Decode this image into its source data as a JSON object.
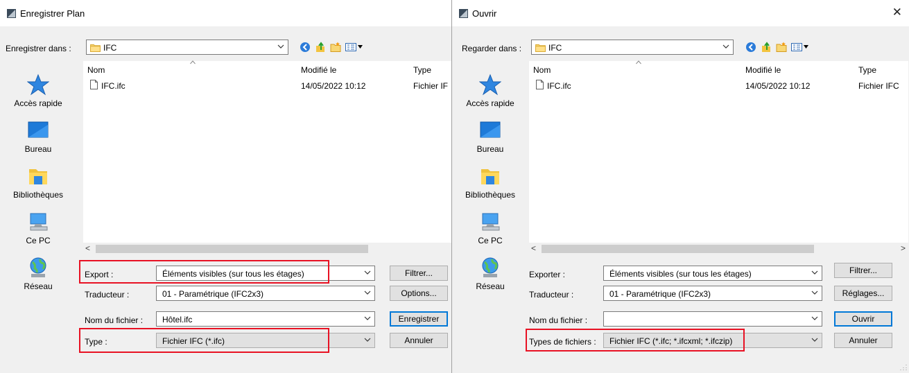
{
  "save_dialog": {
    "title": "Enregistrer Plan",
    "look_in_label": "Enregistrer dans :",
    "folder": "IFC",
    "places": [
      "Accès rapide",
      "Bureau",
      "Bibliothèques",
      "Ce PC",
      "Réseau"
    ],
    "columns": {
      "name": "Nom",
      "modified": "Modifié le",
      "type": "Type"
    },
    "files": [
      {
        "name": "IFC.ifc",
        "modified": "14/05/2022 10:12",
        "type": "Fichier IF"
      }
    ],
    "scroll_left": "<",
    "export_label": "Export :",
    "export_value": "Éléments visibles (sur tous les étages)",
    "translator_label": "Traducteur :",
    "translator_value": "01 - Paramétrique (IFC2x3)",
    "filename_label": "Nom du fichier :",
    "filename_value": "Hôtel.ifc",
    "type_label": "Type :",
    "type_value": "Fichier IFC (*.ifc)",
    "buttons": {
      "filter": "Filtrer...",
      "options": "Options...",
      "save": "Enregistrer",
      "cancel": "Annuler"
    }
  },
  "open_dialog": {
    "title": "Ouvrir",
    "close": "✕",
    "look_in_label": "Regarder dans :",
    "folder": "IFC",
    "places": [
      "Accès rapide",
      "Bureau",
      "Bibliothèques",
      "Ce PC",
      "Réseau"
    ],
    "columns": {
      "name": "Nom",
      "modified": "Modifié le",
      "type": "Type"
    },
    "files": [
      {
        "name": "IFC.ifc",
        "modified": "14/05/2022 10:12",
        "type": "Fichier IFC"
      }
    ],
    "scroll_left": "<",
    "scroll_right": ">",
    "export_label": "Exporter :",
    "export_value": "Éléments visibles (sur tous les étages)",
    "translator_label": "Traducteur :",
    "translator_value": "01 - Paramétrique (IFC2x3)",
    "filename_label": "Nom du fichier :",
    "filename_value": "",
    "type_label": "Types de fichiers :",
    "type_value": "Fichier IFC (*.ifc; *.ifcxml; *.ifczip)",
    "buttons": {
      "filter": "Filtrer...",
      "settings": "Réglages...",
      "open": "Ouvrir",
      "cancel": "Annuler"
    }
  },
  "colors": {
    "highlight_box": "#e81123",
    "default_button_border": "#0078d7",
    "list_background": "#ffffff"
  }
}
